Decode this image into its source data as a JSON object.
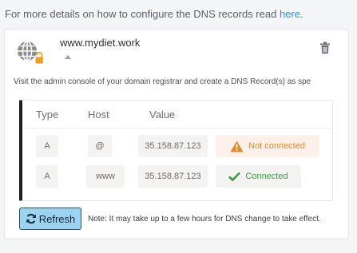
{
  "intro": {
    "text": "For more details on how to configure the DNS records read ",
    "link_label": "here."
  },
  "domain": {
    "name": "www.mydiet.work",
    "icon": "globe-lock-icon"
  },
  "instruction": "Visit the admin console of your domain registrar and create a DNS Record(s) as spe",
  "table": {
    "headers": {
      "type": "Type",
      "host": "Host",
      "value": "Value"
    },
    "rows": [
      {
        "type": "A",
        "host": "@",
        "value": "35.158.87.123",
        "status": "Not connected",
        "status_icon": "warning-icon",
        "status_color": "#e08a2a"
      },
      {
        "type": "A",
        "host": "www",
        "value": "35.158.87.123",
        "status": "Connected",
        "status_icon": "check-icon",
        "status_color": "#3f9a4a"
      }
    ]
  },
  "refresh": {
    "label": "Refresh",
    "note": "Note: It may take up to a few hours for DNS change to take effect."
  },
  "colors": {
    "accent": "#2f8fd6",
    "button": "#9cd3f0",
    "warning": "#e08a2a",
    "success": "#3f9a4a"
  }
}
